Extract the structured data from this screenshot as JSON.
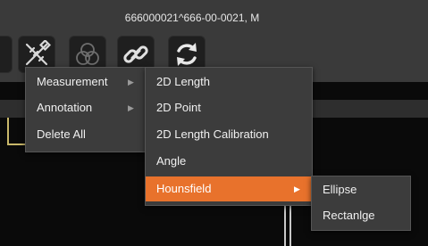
{
  "window": {
    "title": "666000021^666-00-0021, M"
  },
  "toolbar": {
    "tools": [
      {
        "name": "measure-tools-button",
        "icon": "ruler-pencil-icon"
      },
      {
        "name": "color-overlay-button",
        "icon": "overlapping-circles-icon"
      },
      {
        "name": "link-button",
        "icon": "chain-link-icon"
      },
      {
        "name": "refresh-button",
        "icon": "refresh-icon"
      }
    ]
  },
  "menu": {
    "main": [
      {
        "label": "Measurement",
        "has_submenu": true
      },
      {
        "label": "Annotation",
        "has_submenu": true
      },
      {
        "label": "Delete All",
        "has_submenu": false
      }
    ],
    "measurement": [
      {
        "label": "2D Length"
      },
      {
        "label": "2D Point"
      },
      {
        "label": "2D Length Calibration"
      },
      {
        "label": "Angle"
      },
      {
        "label": "Hounsfield",
        "active": true,
        "has_submenu": true
      }
    ],
    "hounsfield": [
      {
        "label": "Ellipse"
      },
      {
        "label": "Rectanlge"
      }
    ]
  },
  "colors": {
    "highlight": "#e8722c",
    "menu_bg": "#3c3c3c",
    "toolbar_bg": "#3a3a3a"
  }
}
